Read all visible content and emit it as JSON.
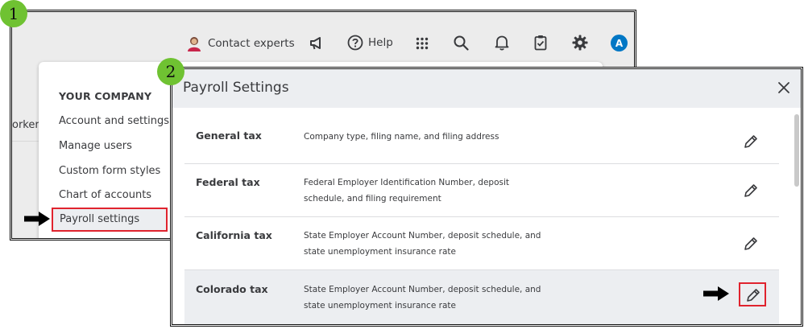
{
  "badges": {
    "step1": "1",
    "step2": "2"
  },
  "topbar": {
    "contact_label": "Contact experts",
    "help_label": "Help",
    "avatar_initial": "A",
    "icons": [
      "megaphone-icon",
      "help-circle-icon",
      "apps-grid-icon",
      "search-icon",
      "bell-icon",
      "clipboard-check-icon",
      "gear-icon"
    ]
  },
  "background": {
    "cut_text": "orker"
  },
  "company_menu": {
    "heading": "YOUR COMPANY",
    "items": [
      "Account and settings",
      "Manage users",
      "Custom form styles",
      "Chart of accounts",
      "Payroll settings"
    ],
    "active_index": 4
  },
  "payroll_settings": {
    "title": "Payroll Settings",
    "rows": [
      {
        "name": "General tax",
        "desc_lines": [
          "Company type, filing name, and filing address"
        ]
      },
      {
        "name": "Federal tax",
        "desc_lines": [
          "Federal Employer Identification Number, deposit",
          "schedule, and filing requirement"
        ]
      },
      {
        "name": "California tax",
        "desc_lines": [
          "State Employer Account Number, deposit schedule, and",
          "state unemployment insurance rate"
        ]
      },
      {
        "name": "Colorado tax",
        "desc_lines": [
          "State Employer Account Number, deposit schedule, and",
          "state unemployment insurance rate"
        ]
      }
    ]
  },
  "colors": {
    "accent_red": "#e0232e",
    "badge_green": "#6fc232",
    "avatar_blue": "#0077c5"
  }
}
